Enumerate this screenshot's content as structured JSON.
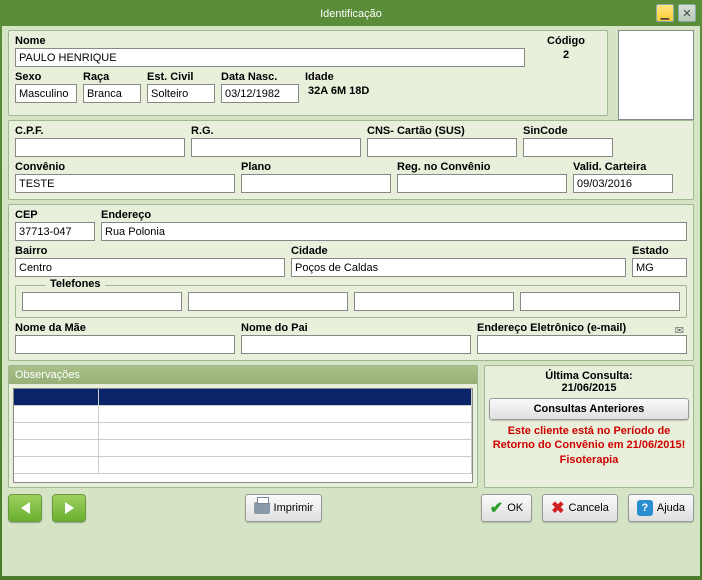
{
  "window": {
    "title": "Identificação"
  },
  "labels": {
    "nome": "Nome",
    "codigo": "Código",
    "sexo": "Sexo",
    "raca": "Raça",
    "est_civil": "Est. Civil",
    "data_nasc": "Data Nasc.",
    "idade": "Idade",
    "cpf": "C.P.F.",
    "rg": "R.G.",
    "cns": "CNS- Cartão (SUS)",
    "sincode": "SinCode",
    "convenio": "Convênio",
    "plano": "Plano",
    "reg_convenio": "Reg. no Convênio",
    "valid_carteira": "Valid. Carteira",
    "cep": "CEP",
    "endereco": "Endereço",
    "bairro": "Bairro",
    "cidade": "Cidade",
    "estado": "Estado",
    "telefones": "Telefones",
    "nome_mae": "Nome da Mãe",
    "nome_pai": "Nome do Pai",
    "email": "Endereço Eletrônico (e-mail)",
    "observacoes": "Observações",
    "ultima_consulta": "Última Consulta:",
    "consultas_anteriores": "Consultas Anteriores"
  },
  "values": {
    "nome": "PAULO HENRIQUE",
    "codigo": "2",
    "sexo": "Masculino",
    "raca": "Branca",
    "est_civil": "Solteiro",
    "data_nasc": "03/12/1982",
    "idade": "32A 6M 18D",
    "cpf": "",
    "rg": "",
    "cns": "",
    "sincode": "",
    "convenio": "TESTE",
    "plano": "",
    "reg_convenio": "",
    "valid_carteira": "09/03/2016",
    "cep": "37713-047",
    "endereco": "Rua Polonia",
    "bairro": "Centro",
    "cidade": "Poços de Caldas",
    "estado": "MG",
    "tel1": "",
    "tel2": "",
    "tel3": "",
    "tel4": "",
    "nome_mae": "",
    "nome_pai": "",
    "email": "",
    "ultima_consulta_data": "21/06/2015",
    "warning": "Este cliente está no Período de Retorno do Convênio em 21/06/2015! Fisoterapia"
  },
  "buttons": {
    "imprimir": "Imprimir",
    "ok": "OK",
    "cancela": "Cancela",
    "ajuda": "Ajuda"
  }
}
